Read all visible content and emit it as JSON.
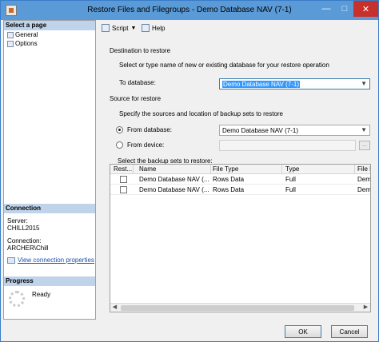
{
  "window": {
    "title": "Restore Files and Filegroups - Demo Database NAV (7-1)"
  },
  "left_pane": {
    "select_page_header": "Select a page",
    "pages": [
      {
        "label": "General"
      },
      {
        "label": "Options"
      }
    ],
    "connection_header": "Connection",
    "server_label": "Server:",
    "server_value": "CHILL2015",
    "connection_label": "Connection:",
    "connection_value": "ARCHER\\Chill",
    "view_connection_link": "View connection properties",
    "progress_header": "Progress",
    "progress_status": "Ready"
  },
  "toolbar": {
    "script_label": "Script",
    "help_label": "Help"
  },
  "destination": {
    "section_label": "Destination to restore",
    "instruction": "Select or type name of new or existing database for your restore operation",
    "to_database_label": "To database:",
    "to_database_value": "Demo Database NAV (7-1)"
  },
  "source": {
    "section_label": "Source for restore",
    "instruction": "Specify the sources and location of backup sets to restore",
    "from_database_label": "From database:",
    "from_database_value": "Demo Database NAV (7-1)",
    "from_device_label": "From device:",
    "browse_label": "...",
    "selected_option": "from_database"
  },
  "backup_sets": {
    "label": "Select the backup sets to restore:",
    "columns": [
      "Rest...",
      "Name",
      "File Type",
      "Type",
      "File L"
    ],
    "rows": [
      {
        "restore": false,
        "name": "Demo Database NAV (...",
        "file_type": "Rows Data",
        "type": "Full",
        "file_l": "Dem"
      },
      {
        "restore": false,
        "name": "Demo Database NAV (...",
        "file_type": "Rows Data",
        "type": "Full",
        "file_l": "Dem"
      }
    ]
  },
  "buttons": {
    "ok": "OK",
    "cancel": "Cancel"
  },
  "colors": {
    "titlebar": "#5a9ad6",
    "pane_header": "#bfd4ea",
    "selection": "#3399ff",
    "close_button": "#c7302b",
    "link": "#1c4fa8"
  }
}
